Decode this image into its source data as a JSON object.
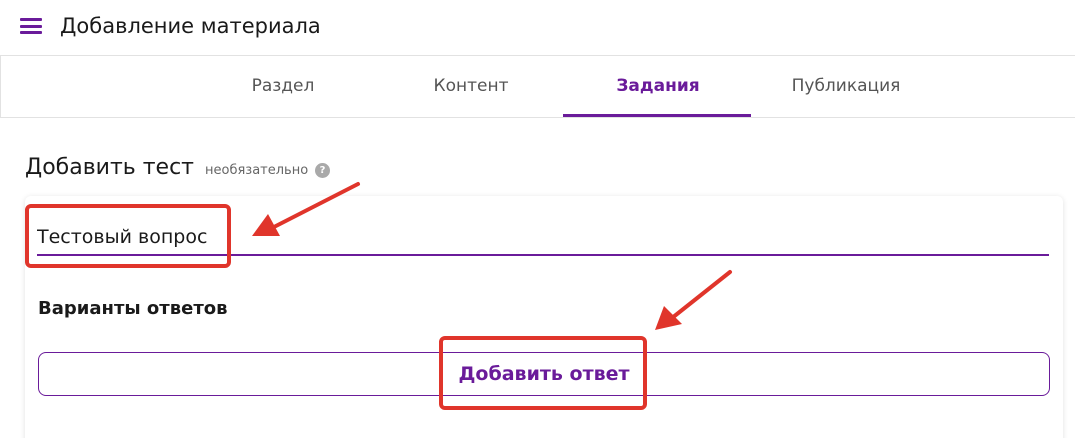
{
  "header": {
    "title": "Добавление материала",
    "menu_icon": "hamburger-menu-icon"
  },
  "tabs": [
    {
      "label": "Раздел",
      "active": false
    },
    {
      "label": "Контент",
      "active": false
    },
    {
      "label": "Задания",
      "active": true
    },
    {
      "label": "Публикация",
      "active": false
    }
  ],
  "section": {
    "title": "Добавить тест",
    "optional_label": "необязательно",
    "help_icon": "question-circle-icon"
  },
  "question": {
    "value": "Тестовый вопрос"
  },
  "answers": {
    "title": "Варианты ответов",
    "add_button_label": "Добавить ответ"
  },
  "colors": {
    "accent": "#6a1b9a",
    "annotation": "#e0352b"
  }
}
